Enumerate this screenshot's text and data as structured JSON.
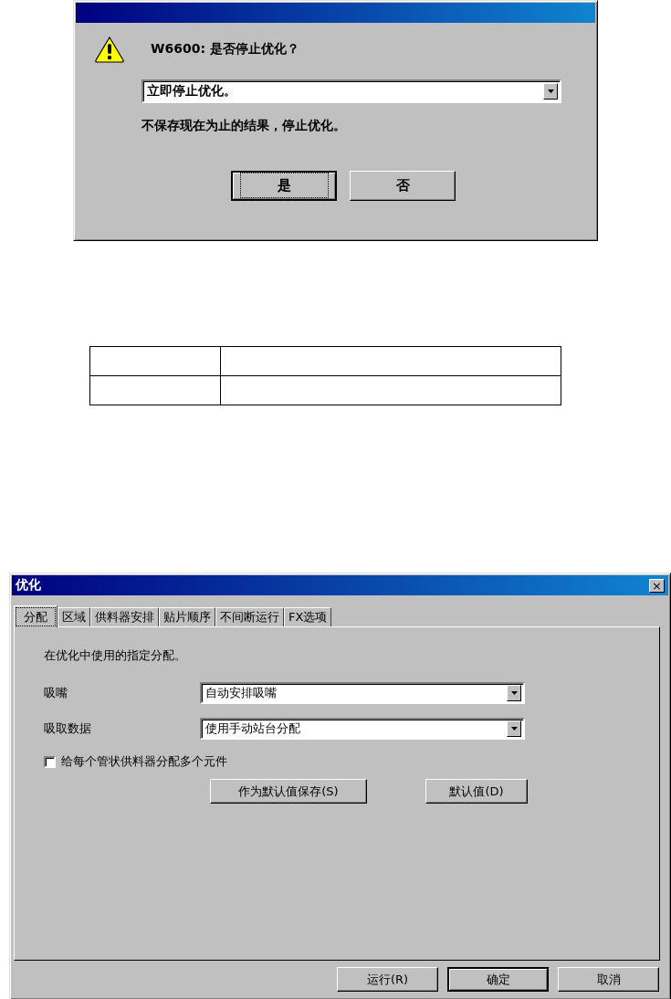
{
  "message_dialog": {
    "message": "W6600: 是否停止优化？",
    "dropdown": {
      "value": "立即停止优化。"
    },
    "description": "不保存现在为止的结果，停止优化。",
    "buttons": [
      {
        "label": "是",
        "default": true
      },
      {
        "label": "否",
        "default": false
      }
    ]
  },
  "optimize_dialog": {
    "title": "优化",
    "close": "×",
    "tabs": [
      {
        "label": "分配",
        "selected": true
      },
      {
        "label": "区域",
        "selected": false
      },
      {
        "label": "供料器安排",
        "selected": false
      },
      {
        "label": "贴片顺序",
        "selected": false
      },
      {
        "label": "不间断运行",
        "selected": false
      },
      {
        "label": "FX选项",
        "selected": false
      }
    ],
    "intro": "在优化中使用的指定分配。",
    "fields": [
      {
        "label": "吸嘴",
        "value": "自动安排吸嘴"
      },
      {
        "label": "吸取数据",
        "value": "使用手动站台分配"
      }
    ],
    "checkbox": {
      "label": "给每个管状供料器分配多个元件",
      "checked": false
    },
    "panel_buttons": [
      "作为默认值保存(S)",
      "默认值(D)"
    ],
    "buttons": [
      {
        "label": "运行(R)",
        "default": false
      },
      {
        "label": "确定",
        "default": true
      },
      {
        "label": "取消",
        "default": false
      }
    ]
  }
}
